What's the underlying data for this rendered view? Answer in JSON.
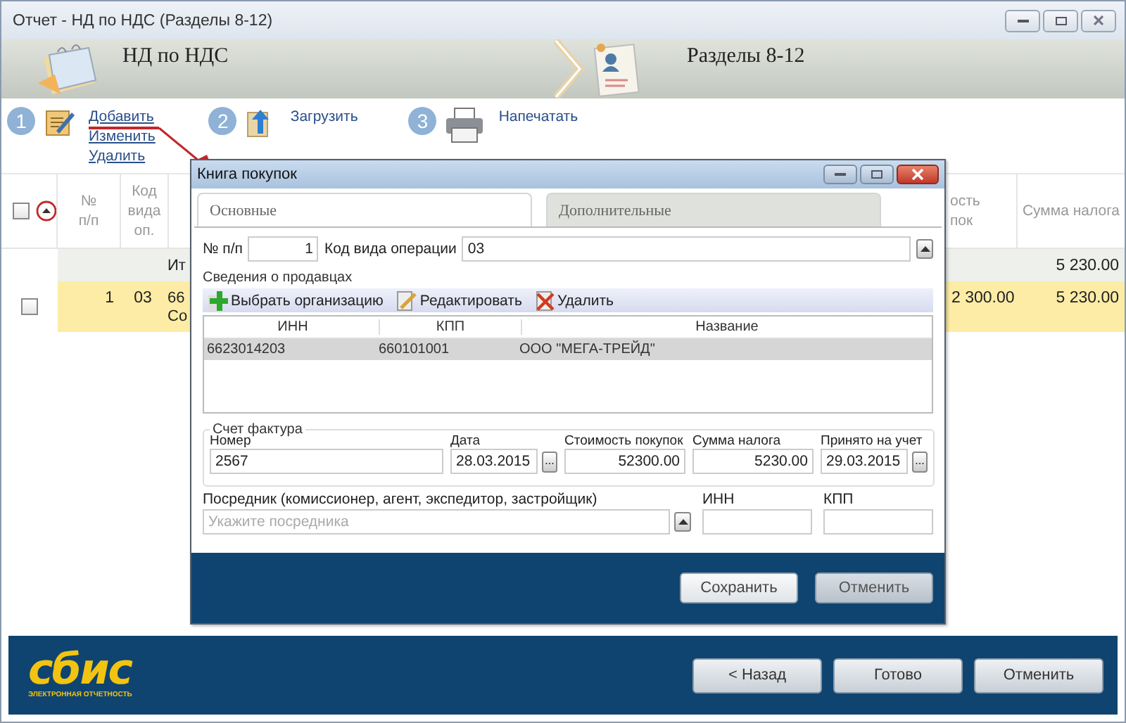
{
  "window": {
    "title": "Отчет - НД по НДС (Разделы 8-12)"
  },
  "wizard": [
    {
      "label": "НД по НДС",
      "kind": "calendar"
    },
    {
      "label": "Разделы 8-12",
      "kind": "profile"
    }
  ],
  "actions": [
    {
      "number": "1",
      "kind": "edit",
      "links": [
        "Добавить",
        "Изменить",
        "Удалить"
      ]
    },
    {
      "number": "2",
      "kind": "upload",
      "links": [
        "Загрузить"
      ]
    },
    {
      "number": "3",
      "kind": "print",
      "links": [
        "Напечатать"
      ]
    }
  ],
  "table": {
    "header_checked": false,
    "columns": [
      {
        "lines": [
          "№",
          "п/п"
        ]
      },
      {
        "lines": [
          "Код",
          "вида",
          "оп."
        ]
      },
      {
        "lines": [
          "ость",
          "пок"
        ]
      },
      {
        "lines": [
          "Сумма налога"
        ]
      }
    ],
    "rows": [
      {
        "kind": "total",
        "selected": false,
        "label": "Ит",
        "tax": "5 230.00"
      },
      {
        "kind": "item",
        "selected": true,
        "checked": false,
        "number": "1",
        "op_code": "03",
        "column_3": [
          "66",
          "Со"
        ],
        "cost": "2 300.00",
        "tax": "5 230.00"
      }
    ]
  },
  "dialog": {
    "title": "Книга покупок",
    "tabs": [
      {
        "label": "Основные",
        "selected": true
      },
      {
        "label": "Дополнительные",
        "selected": false
      }
    ],
    "number_label": "№ п/п",
    "number": "1",
    "op_code_label": "Код вида операции",
    "op_code": "03",
    "sellers": {
      "title": "Сведения о продавцах",
      "tools": [
        {
          "kind": "add",
          "label": "Выбрать организацию"
        },
        {
          "kind": "edit",
          "label": "Редактировать"
        },
        {
          "kind": "delete",
          "label": "Удалить"
        }
      ],
      "columns": [
        "ИНН",
        "КПП",
        "Название"
      ],
      "rows": [
        {
          "selected": true,
          "cells": [
            "6623014203",
            "660101001",
            "ООО \"МЕГА-ТРЕЙД\""
          ]
        }
      ]
    },
    "invoice": {
      "legend": "Счет фактура",
      "fields": [
        {
          "kind": "text",
          "label": "Номер",
          "value": "2567"
        },
        {
          "kind": "date",
          "label": "Дата",
          "value": "28.03.2015",
          "button": "..."
        },
        {
          "kind": "amount",
          "label": "Стоимость покупок",
          "value": "52300.00"
        },
        {
          "kind": "amount",
          "label": "Сумма налога",
          "value": "5230.00"
        },
        {
          "kind": "date",
          "label": "Принято на учет",
          "value": "29.03.2015",
          "button": "..."
        }
      ]
    },
    "intermediary": {
      "label": "Посредник (комиссионер, агент, экспедитор, застройщик)",
      "placeholder": "Укажите посредника",
      "inn_label": "ИНН",
      "kpp_label": "КПП"
    },
    "buttons": [
      {
        "kind": "primary",
        "label": "Сохранить"
      },
      {
        "kind": "secondary",
        "label": "Отменить"
      }
    ]
  },
  "logo": {
    "name": "сбис",
    "tagline": "ЭЛЕКТРОННАЯ ОТЧЕТНОСТЬ"
  },
  "footer_buttons": [
    "< Назад",
    "Готово",
    "Отменить"
  ]
}
